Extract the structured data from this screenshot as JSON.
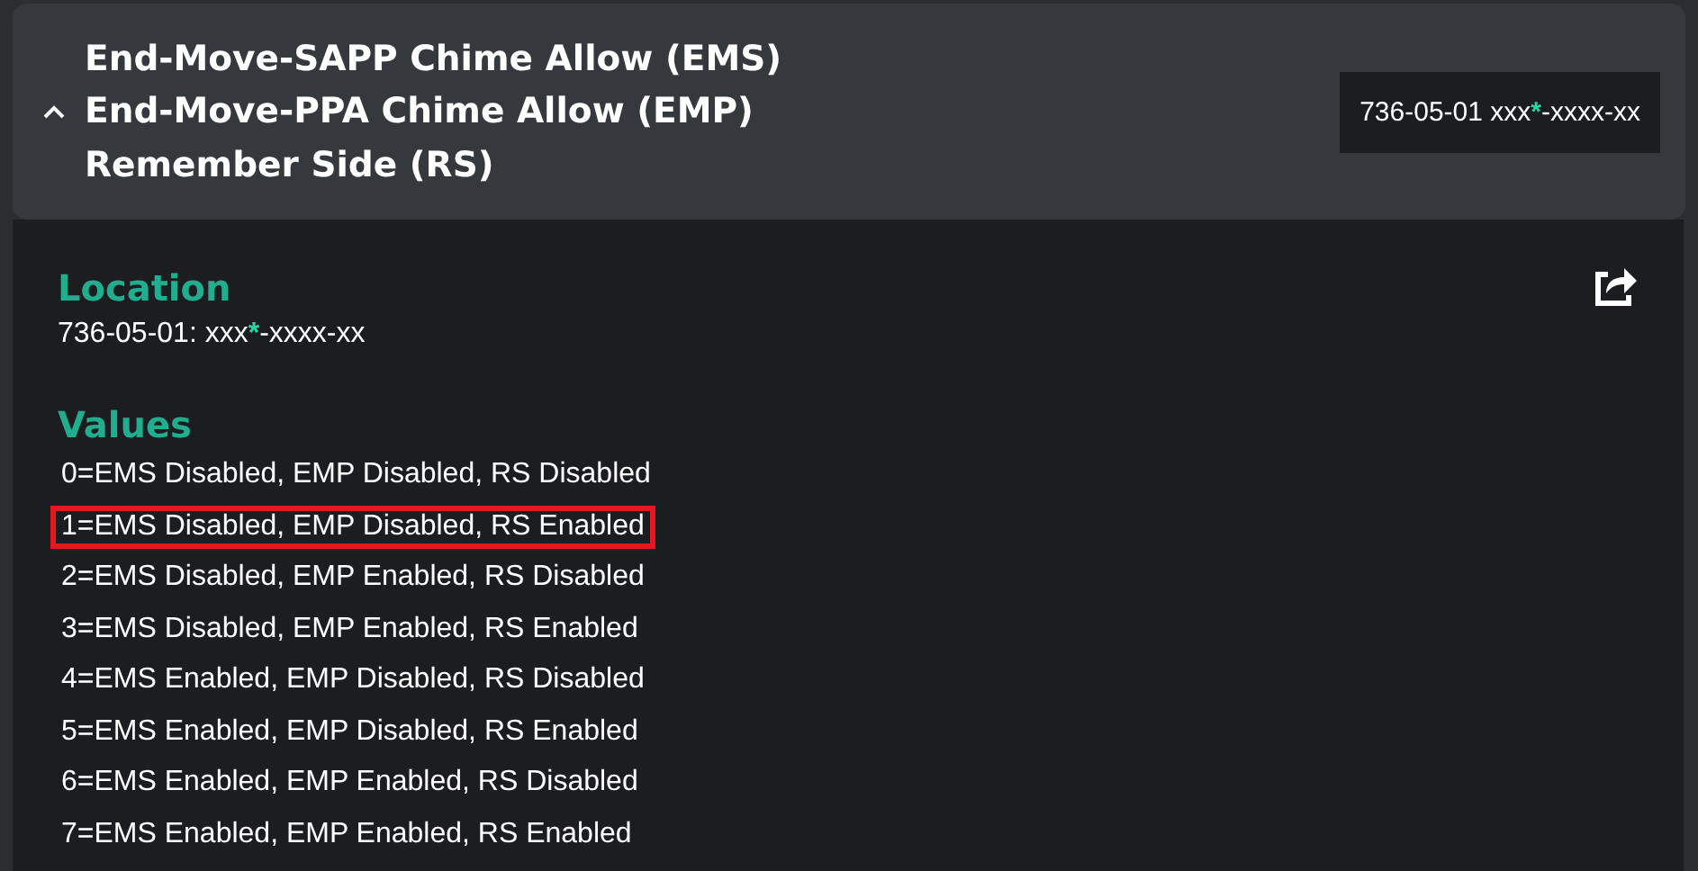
{
  "header": {
    "expanded": true,
    "title_lines": [
      "End-Move-SAPP Chime Allow (EMS)",
      "End-Move-PPA Chime Allow (EMP)",
      "Remember Side (RS)"
    ],
    "tag": {
      "before": "736-05-01 xxx",
      "marked": "*",
      "after": "-xxxx-xx"
    }
  },
  "location": {
    "heading": "Location",
    "text": {
      "before": "736-05-01: xxx",
      "marked": "*",
      "after": "-xxxx-xx"
    }
  },
  "values": {
    "heading": "Values",
    "items": [
      {
        "text": "0=EMS Disabled, EMP Disabled, RS Disabled",
        "selected": false
      },
      {
        "text": "1=EMS Disabled, EMP Disabled, RS Enabled",
        "selected": true
      },
      {
        "text": "2=EMS Disabled, EMP Enabled, RS Disabled",
        "selected": false
      },
      {
        "text": "3=EMS Disabled, EMP Enabled, RS Enabled",
        "selected": false
      },
      {
        "text": "4=EMS Enabled, EMP Disabled, RS Disabled",
        "selected": false
      },
      {
        "text": "5=EMS Enabled, EMP Disabled, RS Enabled",
        "selected": false
      },
      {
        "text": "6=EMS Enabled, EMP Enabled, RS Disabled",
        "selected": false
      },
      {
        "text": "7=EMS Enabled, EMP Enabled, RS Enabled",
        "selected": false
      }
    ]
  }
}
